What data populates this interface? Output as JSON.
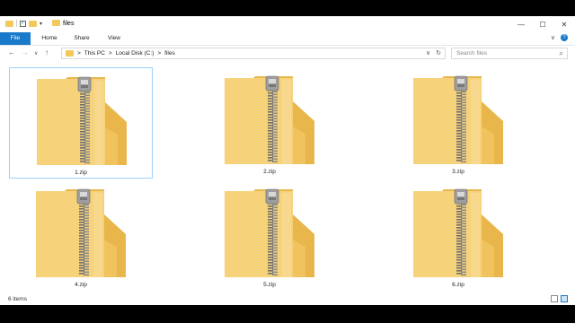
{
  "window": {
    "title": "files"
  },
  "titlebar": {
    "min": "—",
    "max": "☐",
    "close": "✕"
  },
  "ribbon": {
    "tabs": [
      "File",
      "Home",
      "Share",
      "View"
    ],
    "expand": "∨",
    "help": "?"
  },
  "address": {
    "back": "←",
    "forward": "→",
    "recent": "∨",
    "up": "↑",
    "crumbs": [
      "This PC",
      "Local Disk (C:)",
      "files"
    ],
    "sep": ">",
    "dropdown": "∨",
    "refresh": "↻",
    "search_placeholder": "Search files"
  },
  "files": [
    {
      "name": "1.zip",
      "selected": true
    },
    {
      "name": "2.zip",
      "selected": false
    },
    {
      "name": "3.zip",
      "selected": false
    },
    {
      "name": "4.zip",
      "selected": false
    },
    {
      "name": "5.zip",
      "selected": false
    },
    {
      "name": "6.zip",
      "selected": false
    }
  ],
  "status": {
    "count": "6 items"
  },
  "colors": {
    "accent": "#1979ca",
    "folder": "#f3c95a",
    "selection_border": "#99d1ff"
  }
}
